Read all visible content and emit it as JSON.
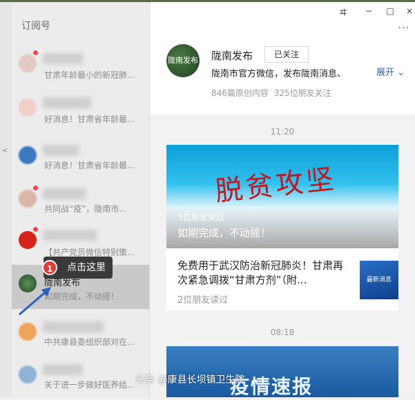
{
  "sidebar": {
    "title": "订阅号",
    "items": [
      {
        "name": "",
        "preview": "甘肃年龄最小的新冠肺..."
      },
      {
        "name": "",
        "preview": "好消息！甘肃省年龄最..."
      },
      {
        "name": "",
        "preview": "好消息！甘肃省年龄最..."
      },
      {
        "name": "",
        "preview": "共同战“疫”，陇南市..."
      },
      {
        "name": "",
        "preview": "【共产党员微信特别策..."
      },
      {
        "name": "陇南发布",
        "preview": "如期完成，不动摇！"
      },
      {
        "name": "",
        "preview": "中共康县委组织部对在..."
      },
      {
        "name": "",
        "preview": "关于进一步做好医养结..."
      }
    ]
  },
  "tooltip": {
    "badge": "1",
    "text": "点击这里"
  },
  "window": {
    "pin": "ヰ",
    "minimize": "−",
    "maximize": "□",
    "close": "×",
    "more": "···"
  },
  "account": {
    "logo_text": "陇南发布",
    "name": "陇南发布",
    "follow_label": "已关注",
    "description": "陇南市官方微信，发布陇南消息、",
    "expand_label": "展开",
    "stats": "846篇原创内容 325位朋友关注"
  },
  "feed": {
    "time1": "11:20",
    "hero_text": "脱贫攻坚",
    "article1": {
      "reads": "3位朋友读过",
      "title": "如期完成，不动摇！"
    },
    "article2": {
      "title": "免费用于武汉防治新冠肺炎！甘肃再次紧急调拨“甘肃方剂”（附...",
      "reads": "2位朋友读过",
      "thumb_text": "最新消息"
    },
    "time2": "08:18",
    "card2_text": "疫情速报"
  },
  "watermark": "头条 @康县长坝镇卫生院",
  "colors": {
    "accent_link": "#2f63b5",
    "badge_red": "#e53935"
  }
}
